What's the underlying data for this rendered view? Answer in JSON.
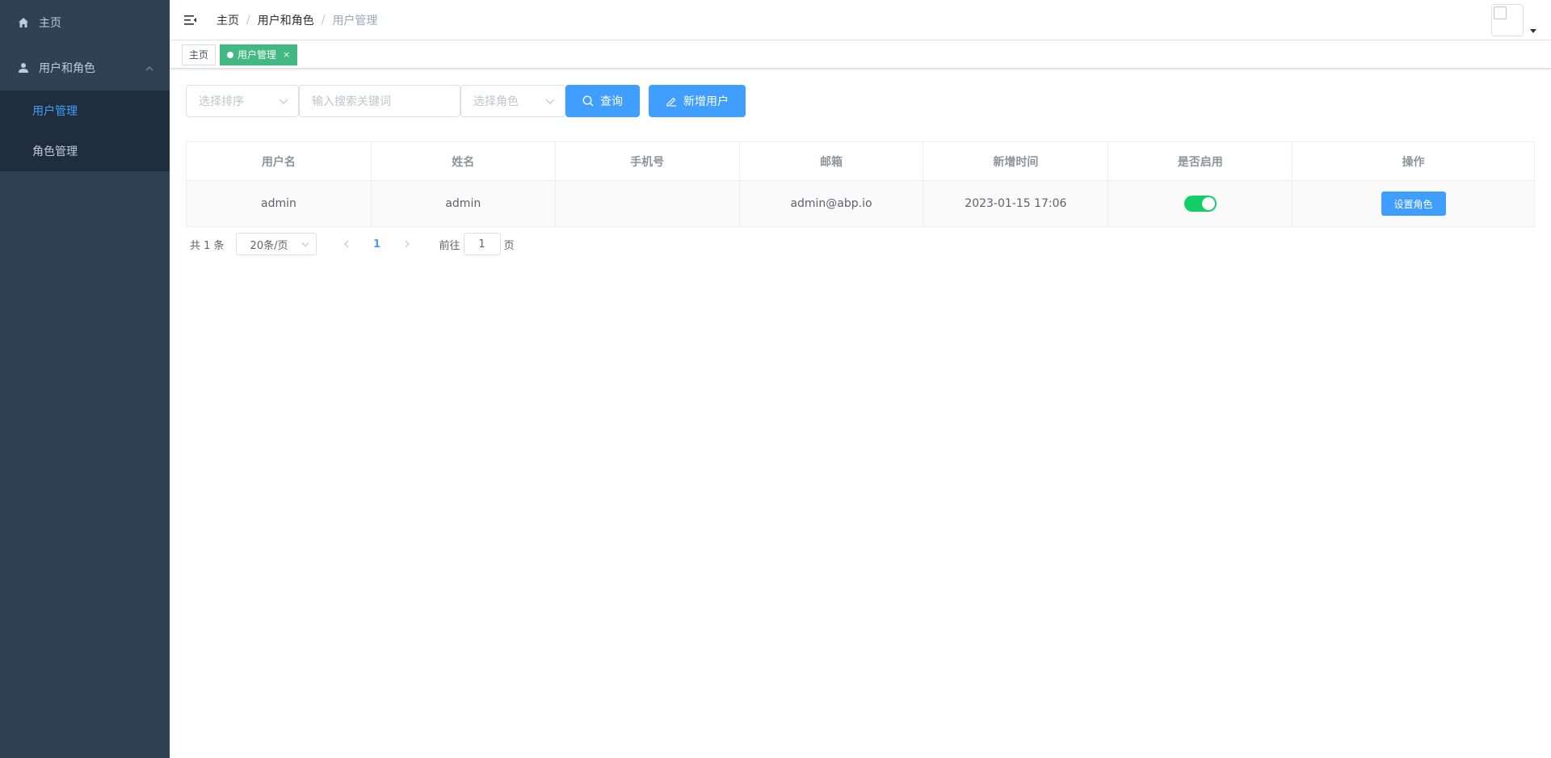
{
  "sidebar": {
    "home_label": "主页",
    "group_label": "用户和角色",
    "items": [
      {
        "label": "用户管理"
      },
      {
        "label": "角色管理"
      }
    ]
  },
  "navbar": {
    "breadcrumb": [
      "主页",
      "用户和角色",
      "用户管理"
    ],
    "separator": "/"
  },
  "tags": {
    "home": "主页",
    "active": "用户管理",
    "close": "×"
  },
  "filter": {
    "sort_placeholder": "选择排序",
    "search_placeholder": "输入搜索关键词",
    "role_placeholder": "选择角色",
    "query_label": "查询",
    "add_user_label": "新增用户"
  },
  "table": {
    "headers": [
      "用户名",
      "姓名",
      "手机号",
      "邮箱",
      "新增时间",
      "是否启用",
      "操作"
    ],
    "rows": [
      {
        "username": "admin",
        "name": "admin",
        "phone": "",
        "email": "admin@abp.io",
        "created": "2023-01-15 17:06",
        "enabled": true,
        "action": "设置角色"
      }
    ]
  },
  "pagination": {
    "total": "共 1 条",
    "page_size": "20条/页",
    "current_page": "1",
    "goto_prefix": "前往",
    "goto_value": "1",
    "goto_suffix": "页"
  },
  "colors": {
    "sidebar_bg": "#304156",
    "submenu_bg": "#1f2d3d",
    "primary": "#409eff",
    "tag_active": "#42b983",
    "switch_on": "#13ce66"
  }
}
